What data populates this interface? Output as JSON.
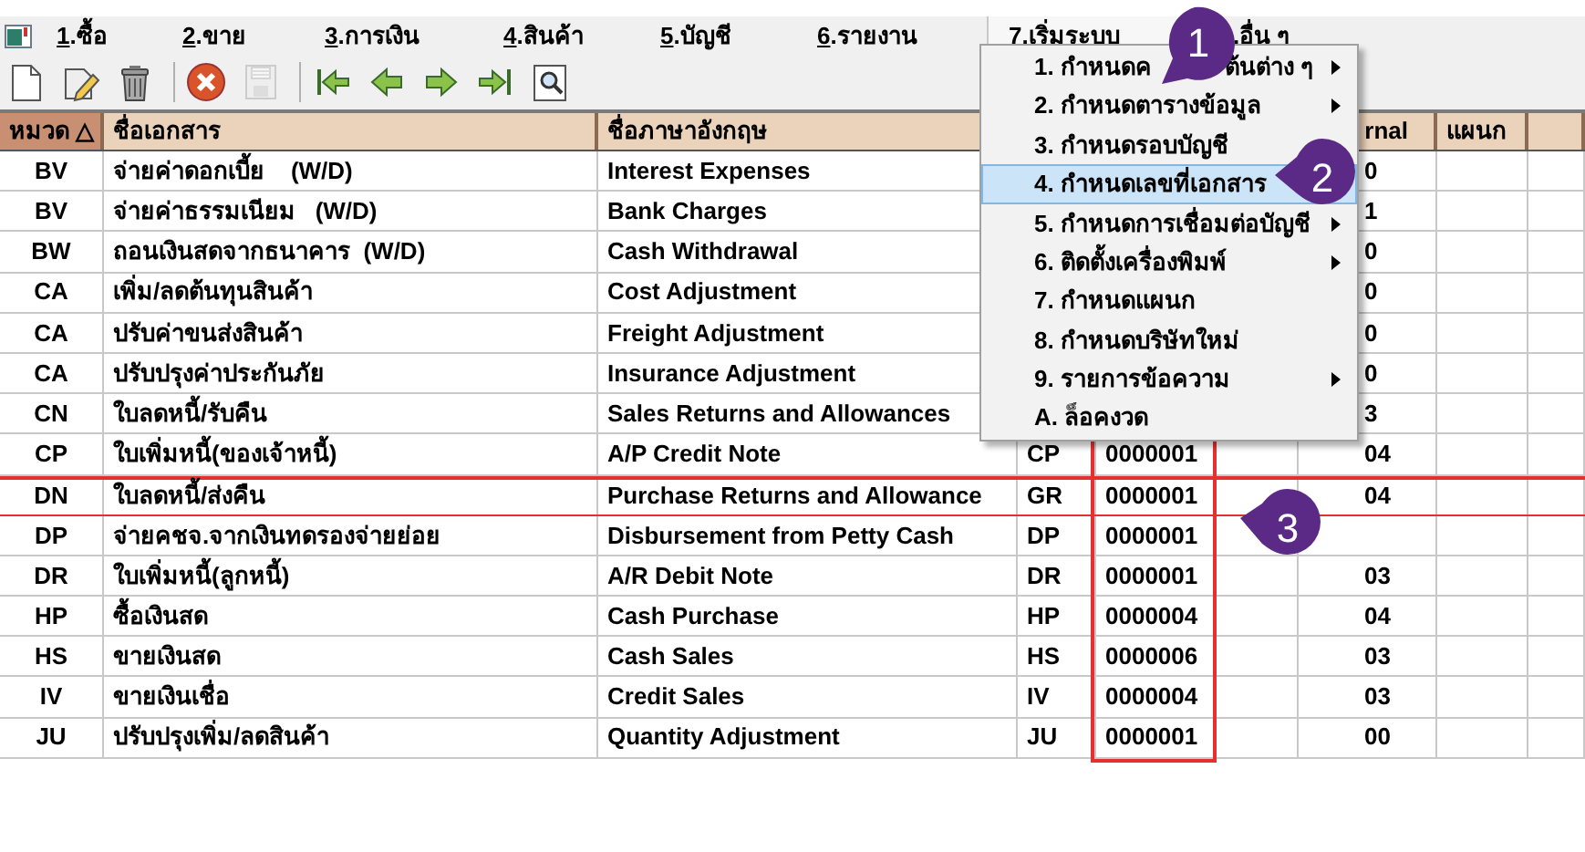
{
  "menu_bar": [
    {
      "key": "1",
      "label": ".ซื้อ",
      "selected": false
    },
    {
      "key": "2",
      "label": ".ขาย",
      "selected": false
    },
    {
      "key": "3",
      "label": ".การเงิน",
      "selected": false
    },
    {
      "key": "4",
      "label": ".สินค้า",
      "selected": false
    },
    {
      "key": "5",
      "label": ".บัญชี",
      "selected": false
    },
    {
      "key": "6",
      "label": ".รายงาน",
      "selected": false
    },
    {
      "key": "7",
      "label": ".เริ่มระบบ",
      "selected": true
    },
    {
      "label": ".อื่น ๆ",
      "selected": false
    }
  ],
  "toolbar": [
    {
      "kind": "new",
      "disabled": false
    },
    {
      "kind": "edit",
      "disabled": false
    },
    {
      "kind": "delete",
      "disabled": false
    },
    {
      "kind": "separator"
    },
    {
      "kind": "cancel",
      "disabled": false
    },
    {
      "kind": "save",
      "disabled": true
    },
    {
      "kind": "separator"
    },
    {
      "kind": "first",
      "disabled": false
    },
    {
      "kind": "previous",
      "disabled": false
    },
    {
      "kind": "next",
      "disabled": false
    },
    {
      "kind": "last",
      "disabled": false
    },
    {
      "kind": "find",
      "disabled": false
    }
  ],
  "table": {
    "columns": [
      {
        "label": "หมวด △",
        "sorted": true
      },
      {
        "label": "ชื่อเอกสาร",
        "sorted": false
      },
      {
        "label": "ชื่อภาษาอังกฤษ",
        "sorted": false
      },
      {},
      {},
      {
        "label": "rnal",
        "sorted": false
      },
      {
        "label": "แผนก",
        "sorted": false
      },
      {
        "sorted": false
      }
    ],
    "rows": [
      {
        "code": "BV",
        "name": "จ่ายค่าดอกเบี้ย    (W/D)",
        "english": "Interest Expenses",
        "journal": "0",
        "outlined": false
      },
      {
        "code": "BV",
        "name": "จ่ายค่าธรรมเนียม   (W/D)",
        "english": "Bank Charges",
        "journal": "1",
        "outlined": false
      },
      {
        "code": "BW",
        "name": "ถอนเงินสดจากธนาคาร  (W/D)",
        "english": "Cash Withdrawal",
        "journal": "0",
        "outlined": false
      },
      {
        "code": "CA",
        "name": "เพิ่ม/ลดต้นทุนสินค้า",
        "english": "Cost Adjustment",
        "journal": "0",
        "outlined": false
      },
      {
        "code": "CA",
        "name": "ปรับค่าขนส่งสินค้า",
        "english": "Freight Adjustment",
        "journal": "0",
        "outlined": false
      },
      {
        "code": "CA",
        "name": "ปรับปรุงค่าประกันภัย",
        "english": "Insurance Adjustment",
        "journal": "0",
        "outlined": false
      },
      {
        "code": "CN",
        "name": "ใบลดหนี้/รับคืน",
        "english": "Sales Returns and Allowances",
        "journal": "3",
        "outlined": false
      },
      {
        "code": "CP",
        "name": "ใบเพิ่มหนี้(ของเจ้าหนี้)",
        "english": "A/P Credit Note",
        "prefix": "CP",
        "number": "0000001",
        "journal": "04",
        "outlined": false,
        "number_boxed": true
      },
      {
        "code": "DN",
        "name": "ใบลดหนี้/ส่งคืน",
        "english": "Purchase Returns and Allowance",
        "prefix": "GR",
        "number": "0000001",
        "journal": "04",
        "outlined": true,
        "number_boxed": true
      },
      {
        "code": "DP",
        "name": "จ่ายคชจ.จากเงินทดรองจ่ายย่อย",
        "english": "Disbursement from Petty Cash",
        "prefix": "DP",
        "number": "0000001",
        "outlined": false,
        "number_boxed": true
      },
      {
        "code": "DR",
        "name": "ใบเพิ่มหนี้(ลูกหนี้)",
        "english": "A/R Debit Note",
        "prefix": "DR",
        "number": "0000001",
        "journal": "03",
        "outlined": false,
        "number_boxed": true
      },
      {
        "code": "HP",
        "name": "ซื้อเงินสด",
        "english": "Cash Purchase",
        "prefix": "HP",
        "number": "0000004",
        "journal": "04",
        "outlined": false,
        "number_boxed": true
      },
      {
        "code": "HS",
        "name": "ขายเงินสด",
        "english": "Cash Sales",
        "prefix": "HS",
        "number": "0000006",
        "journal": "03",
        "outlined": false,
        "number_boxed": true
      },
      {
        "code": "IV",
        "name": "ขายเงินเชื่อ",
        "english": "Credit Sales",
        "prefix": "IV",
        "number": "0000004",
        "journal": "03",
        "outlined": false,
        "number_boxed": true
      },
      {
        "code": "JU",
        "name": "ปรับปรุงเพิ่ม/ลดสินค้า",
        "english": "Quantity Adjustment",
        "prefix": "JU",
        "number": "0000001",
        "journal": "00",
        "outlined": false,
        "number_boxed": true
      }
    ]
  },
  "dropdown_menu": [
    {
      "label": "1. กำหนดค",
      "label_tail": "ต้นต่าง ๆ",
      "submenu": true,
      "selected": false
    },
    {
      "label": "2. กำหนดตารางข้อมูล",
      "submenu": true,
      "selected": false
    },
    {
      "label": "3. กำหนดรอบบัญชี",
      "submenu": false,
      "selected": false
    },
    {
      "label": "4. กำหนดเลขที่เอกสาร",
      "submenu": false,
      "selected": true
    },
    {
      "label": "5. กำหนดการเชื่อมต่อบัญชี",
      "submenu": true,
      "selected": false
    },
    {
      "label": "6. ติดตั้งเครื่องพิมพ์",
      "submenu": true,
      "selected": false
    },
    {
      "label": "7. กำหนดแผนก",
      "submenu": false,
      "selected": false
    },
    {
      "label": "8. กำหนดบริษัทใหม่",
      "submenu": false,
      "selected": false
    },
    {
      "label": "9. รายการข้อความ",
      "submenu": true,
      "selected": false
    },
    {
      "label": "A. ล็อคงวด",
      "submenu": false,
      "selected": false
    }
  ],
  "callouts": [
    {
      "number": "1"
    },
    {
      "number": "2"
    },
    {
      "number": "3"
    }
  ]
}
